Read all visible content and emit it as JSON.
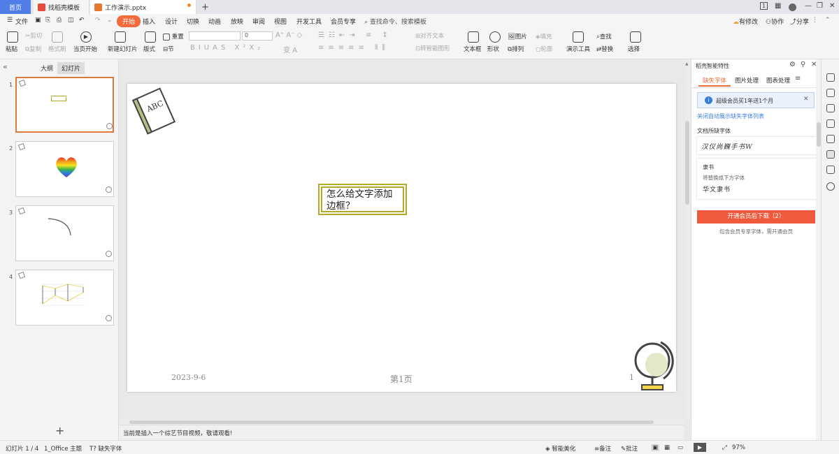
{
  "tabs": {
    "home": "首页",
    "template": "找稻壳模板",
    "document": "工作演示.pptx",
    "new_tab": "+"
  },
  "window": {
    "count_badge": "1"
  },
  "menu": {
    "file": "文件",
    "items": [
      "开始",
      "插入",
      "设计",
      "切换",
      "动画",
      "放映",
      "审阅",
      "视图",
      "开发工具",
      "会员专享"
    ],
    "search_placeholder": "查找命令、搜索模板",
    "right": {
      "edit": "有修改",
      "collab": "协作",
      "share": "分享"
    }
  },
  "ribbon": {
    "paste": "粘贴",
    "cut": "剪切",
    "copy": "复制",
    "format_painter": "格式刷",
    "from_current": "当页开始",
    "new_slide": "新建幻灯片",
    "layout": "版式",
    "reset": "重置",
    "section": "节",
    "font_size": "0",
    "align_text": "对齐文本",
    "smart_graphic": "转智能图形",
    "textbox": "文本框",
    "shape": "形状",
    "picture": "图片",
    "arrange": "排列",
    "fill": "填充",
    "outline": "轮廓",
    "present_tools": "演示工具",
    "find": "查找",
    "replace": "替换",
    "select": "选择"
  },
  "left_pane": {
    "tab_outline": "大纲",
    "tab_slides": "幻灯片",
    "slide_numbers": [
      "1",
      "2",
      "3",
      "4"
    ],
    "add": "+"
  },
  "slide": {
    "book_label": "ABC",
    "text": "怎么给文字添加边框？",
    "date": "2023-9-6",
    "page_label": "第1页",
    "page_num": "1"
  },
  "notes": "当前是插入一个综艺节目视频，敬请观看!",
  "right_panel": {
    "title": "稻壳智能特性",
    "tabs": [
      "缺失字体",
      "图片处理",
      "图表处理"
    ],
    "banner": "超级会员买1年送1个月",
    "close_auto_link": "关闭自动展示缺失字体列表",
    "missing_fonts_heading": "文档所缺字体",
    "missing_font_sample": "汉仪尚巍手书W",
    "lishu_title": "隶书",
    "replace_hint": "将替换成下方字体",
    "lishu_sample": "华文隶书",
    "download_button": "开通会员后下载（2）",
    "download_hint": "包含会员专享字体，需开通会员"
  },
  "status": {
    "slide_count": "幻灯片 1 / 4",
    "theme": "1_Office 主题",
    "missing_font": "缺失字体",
    "beautify": "智能美化",
    "notes": "备注",
    "comments": "批注",
    "zoom": "97%"
  },
  "colors": {
    "accent": "#f26b3a",
    "home_tab": "#4f7ee8",
    "textbox_border": "#b5a92b",
    "download_button": "#f05a3c",
    "selected_thumb": "#e07a3c"
  }
}
